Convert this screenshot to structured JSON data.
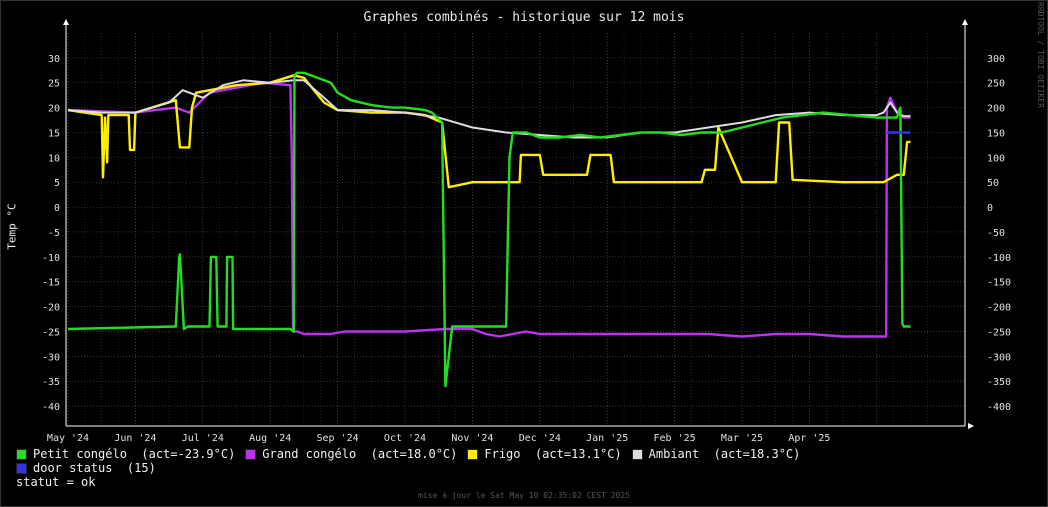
{
  "page": {
    "title": "Graphes combinés - historique sur 12 mois",
    "vendor_tag": "RRDTOOL / TOBI OETIKER",
    "footer": "mise à jour le Sat May 10 02:35:02 CEST 2025",
    "status": "statut = ok"
  },
  "chart_data": {
    "type": "line",
    "title": "Graphes combinés - historique sur 12 mois",
    "ylabel": "Temp °C",
    "xlabel": "",
    "ylim": [
      -44,
      35
    ],
    "y2lim": [
      -440,
      350
    ],
    "yticks": [
      -40,
      -35,
      -30,
      -25,
      -20,
      -15,
      -10,
      -5,
      0,
      5,
      10,
      15,
      20,
      25,
      30
    ],
    "y2ticks": [
      -400,
      -350,
      -300,
      -250,
      -200,
      -150,
      -100,
      -50,
      0,
      50,
      100,
      150,
      200,
      250,
      300
    ],
    "xlim": [
      0,
      12.8
    ],
    "grid": true,
    "legend_position": "bottom-left",
    "categories": [
      "May '24",
      "Jun '24",
      "Jul '24",
      "Aug '24",
      "Sep '24",
      "Oct '24",
      "Nov '24",
      "Dec '24",
      "Jan '25",
      "Feb '25",
      "Mar '25",
      "Apr '25"
    ],
    "category_positions": [
      0,
      1,
      2,
      3,
      4,
      5,
      6,
      7,
      8,
      9,
      10,
      11
    ],
    "series": [
      {
        "name": "Petit congélo",
        "legend": "Petit congélo  (act=-23.9°C)",
        "color": "#22dd22",
        "x": [
          0,
          1.6,
          1.65,
          1.66,
          1.72,
          1.78,
          1.84,
          2.1,
          2.12,
          2.2,
          2.22,
          2.35,
          2.36,
          2.44,
          2.45,
          3.3,
          3.35,
          3.36,
          3.4,
          3.5,
          3.9,
          4.0,
          4.2,
          4.5,
          4.8,
          5.0,
          5.3,
          5.4,
          5.55,
          5.6,
          5.7,
          6.0,
          6.3,
          6.5,
          6.55,
          6.6,
          6.8,
          6.9,
          7.0,
          7.3,
          7.6,
          7.9,
          8.2,
          8.5,
          8.8,
          9.1,
          9.4,
          9.7,
          10.0,
          10.3,
          10.6,
          10.9,
          11.2,
          11.6,
          12.0,
          12.1,
          12.3,
          12.32,
          12.35,
          12.38,
          12.4,
          12.45,
          12.5
        ],
        "y": [
          -24.5,
          -24,
          -10,
          -9.5,
          -24.5,
          -24,
          -24,
          -24,
          -10,
          -10,
          -24,
          -24,
          -10,
          -10,
          -24.5,
          -24.5,
          -25,
          26.5,
          27,
          27,
          25,
          23,
          21.5,
          20.5,
          20,
          20,
          19.5,
          19,
          17,
          -36,
          -24,
          -24,
          -24,
          -24,
          10,
          15,
          15,
          14.5,
          14,
          14,
          14.5,
          14,
          14.5,
          15,
          15,
          14.5,
          15,
          15,
          16,
          17,
          18,
          18.5,
          19,
          18.5,
          18,
          18,
          18,
          19,
          20,
          -23.5,
          -24,
          -24,
          -24
        ]
      },
      {
        "name": "Grand congélo",
        "legend": "Grand congélo  (act=18.0°C)",
        "color": "#bb33ee",
        "x": [
          0,
          1.0,
          1.6,
          1.8,
          2.1,
          2.5,
          2.9,
          3.3,
          3.32,
          3.34,
          3.4,
          3.5,
          3.9,
          4.1,
          4.5,
          5.0,
          5.6,
          6.0,
          6.2,
          6.4,
          6.6,
          6.8,
          7.0,
          7.5,
          8.0,
          8.5,
          9.0,
          9.5,
          10.0,
          10.5,
          11.0,
          11.5,
          12.1,
          12.14,
          12.15,
          12.2,
          12.3,
          12.4,
          12.5
        ],
        "y": [
          19.5,
          19,
          20,
          19,
          23,
          24,
          25,
          24.5,
          10,
          -25,
          -25,
          -25.5,
          -25.5,
          -25,
          -25,
          -25,
          -24.5,
          -24.5,
          -25.5,
          -26,
          -25.5,
          -25,
          -25.5,
          -25.5,
          -25.5,
          -25.5,
          -25.5,
          -25.5,
          -26,
          -25.5,
          -25.5,
          -26,
          -26,
          -26,
          20,
          22,
          19,
          18,
          18
        ]
      },
      {
        "name": "Frigo",
        "legend": "Frigo  (act=13.1°C)",
        "color": "#ffee00",
        "x": [
          0,
          0.5,
          0.52,
          0.55,
          0.58,
          0.6,
          0.9,
          0.92,
          0.98,
          1.0,
          1.6,
          1.66,
          1.8,
          1.84,
          1.9,
          2.5,
          3.0,
          3.35,
          3.5,
          3.8,
          4.0,
          4.5,
          5.0,
          5.3,
          5.55,
          5.65,
          6.0,
          6.2,
          6.3,
          6.7,
          6.72,
          6.75,
          7.0,
          7.05,
          7.5,
          7.7,
          7.75,
          8.05,
          8.1,
          8.5,
          9.0,
          9.4,
          9.45,
          9.6,
          9.65,
          10.0,
          10.2,
          10.5,
          10.55,
          10.7,
          10.75,
          11.5,
          12.0,
          12.1,
          12.3,
          12.4,
          12.45,
          12.5
        ],
        "y": [
          19.5,
          18.5,
          6,
          18,
          9,
          18.5,
          18.5,
          11.5,
          11.5,
          19,
          21.5,
          12,
          12,
          20,
          23,
          24.5,
          25,
          26.5,
          26,
          21,
          19.5,
          19,
          19,
          18.5,
          17,
          4,
          5,
          5,
          5,
          5,
          10.5,
          10.5,
          10.5,
          6.5,
          6.5,
          6.5,
          10.5,
          10.5,
          5,
          5,
          5,
          5,
          7.5,
          7.5,
          16,
          5,
          5,
          5,
          17,
          17,
          5.5,
          5,
          5,
          5,
          6.5,
          6.5,
          13.1,
          13.1
        ]
      },
      {
        "name": "Ambiant",
        "legend": "Ambiant  (act=18.3°C)",
        "color": "#dddddd",
        "x": [
          0,
          0.5,
          1.0,
          1.5,
          1.7,
          2.0,
          2.3,
          2.6,
          3.0,
          3.35,
          3.5,
          3.8,
          4.0,
          4.5,
          5.0,
          5.5,
          6.0,
          6.5,
          7.0,
          7.5,
          8.0,
          8.5,
          9.0,
          9.5,
          10.0,
          10.5,
          11.0,
          11.5,
          12.0,
          12.1,
          12.2,
          12.3,
          12.4,
          12.5
        ],
        "y": [
          19.5,
          19,
          19,
          21,
          23.5,
          22,
          24.5,
          25.5,
          25,
          25.5,
          25.5,
          22,
          19.5,
          19.5,
          19,
          18,
          16,
          15,
          14.5,
          14,
          14,
          15,
          15,
          16,
          17,
          18.5,
          19,
          18.5,
          18.5,
          19,
          21,
          19,
          18.3,
          18.3
        ]
      },
      {
        "name": "door status",
        "legend": "door status  (15)",
        "color": "#3333ee",
        "x": [
          12.15,
          12.5
        ],
        "y": [
          15,
          15
        ]
      }
    ]
  }
}
